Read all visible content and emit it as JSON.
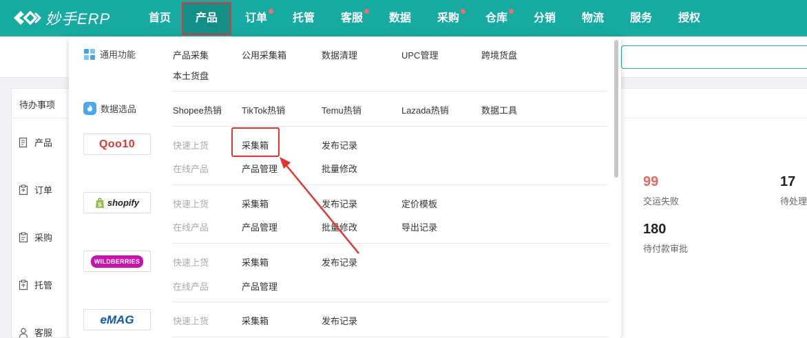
{
  "app": {
    "logo_text": "妙手ERP"
  },
  "nav": [
    {
      "label": "首页",
      "dot": false
    },
    {
      "label": "产品",
      "dot": false,
      "active": true
    },
    {
      "label": "订单",
      "dot": true
    },
    {
      "label": "托管",
      "dot": false
    },
    {
      "label": "客服",
      "dot": true
    },
    {
      "label": "数据",
      "dot": false
    },
    {
      "label": "采购",
      "dot": true
    },
    {
      "label": "仓库",
      "dot": true
    },
    {
      "label": "分销",
      "dot": false
    },
    {
      "label": "物流",
      "dot": false
    },
    {
      "label": "服务",
      "dot": false
    },
    {
      "label": "授权",
      "dot": false
    }
  ],
  "todo": {
    "title": "待办事项",
    "items": [
      "产品",
      "订单",
      "采购",
      "托管",
      "客服"
    ]
  },
  "stats": [
    {
      "value": "99",
      "label": "交运失败",
      "color": "#ea6464"
    },
    {
      "value": "17",
      "label": "待处理"
    },
    {
      "value": "180",
      "label": "待付款审批"
    }
  ],
  "menu": {
    "general": {
      "label": "通用功能",
      "links": [
        "产品采集",
        "公用采集箱",
        "数据清理",
        "UPC管理",
        "跨境货盘",
        "本土货盘"
      ]
    },
    "selection": {
      "label": "数据选品",
      "links": [
        "Shopee热销",
        "TikTok热销",
        "Temu热销",
        "Lazada热销",
        "数据工具"
      ]
    },
    "qoo10": {
      "logo": "Qoo10",
      "row1": [
        "快速上货",
        "采集箱",
        "发布记录"
      ],
      "row2": [
        "在线产品",
        "产品管理",
        "批量修改"
      ]
    },
    "shopify": {
      "logo": "shopify",
      "row1": [
        "快速上货",
        "采集箱",
        "发布记录",
        "定价模板"
      ],
      "row2": [
        "在线产品",
        "产品管理",
        "批量修改",
        "导出记录"
      ]
    },
    "wildberries": {
      "logo": "WILDBERRIES",
      "row1": [
        "快速上货",
        "采集箱",
        "发布记录"
      ],
      "row2": [
        "在线产品",
        "产品管理"
      ]
    },
    "emag": {
      "logo": "eMAG",
      "row1": [
        "快速上货",
        "采集箱",
        "发布记录"
      ]
    }
  },
  "colors": {
    "brand": "#16aaa1",
    "highlight": "#e5342e",
    "dot": "#f36d6d"
  }
}
